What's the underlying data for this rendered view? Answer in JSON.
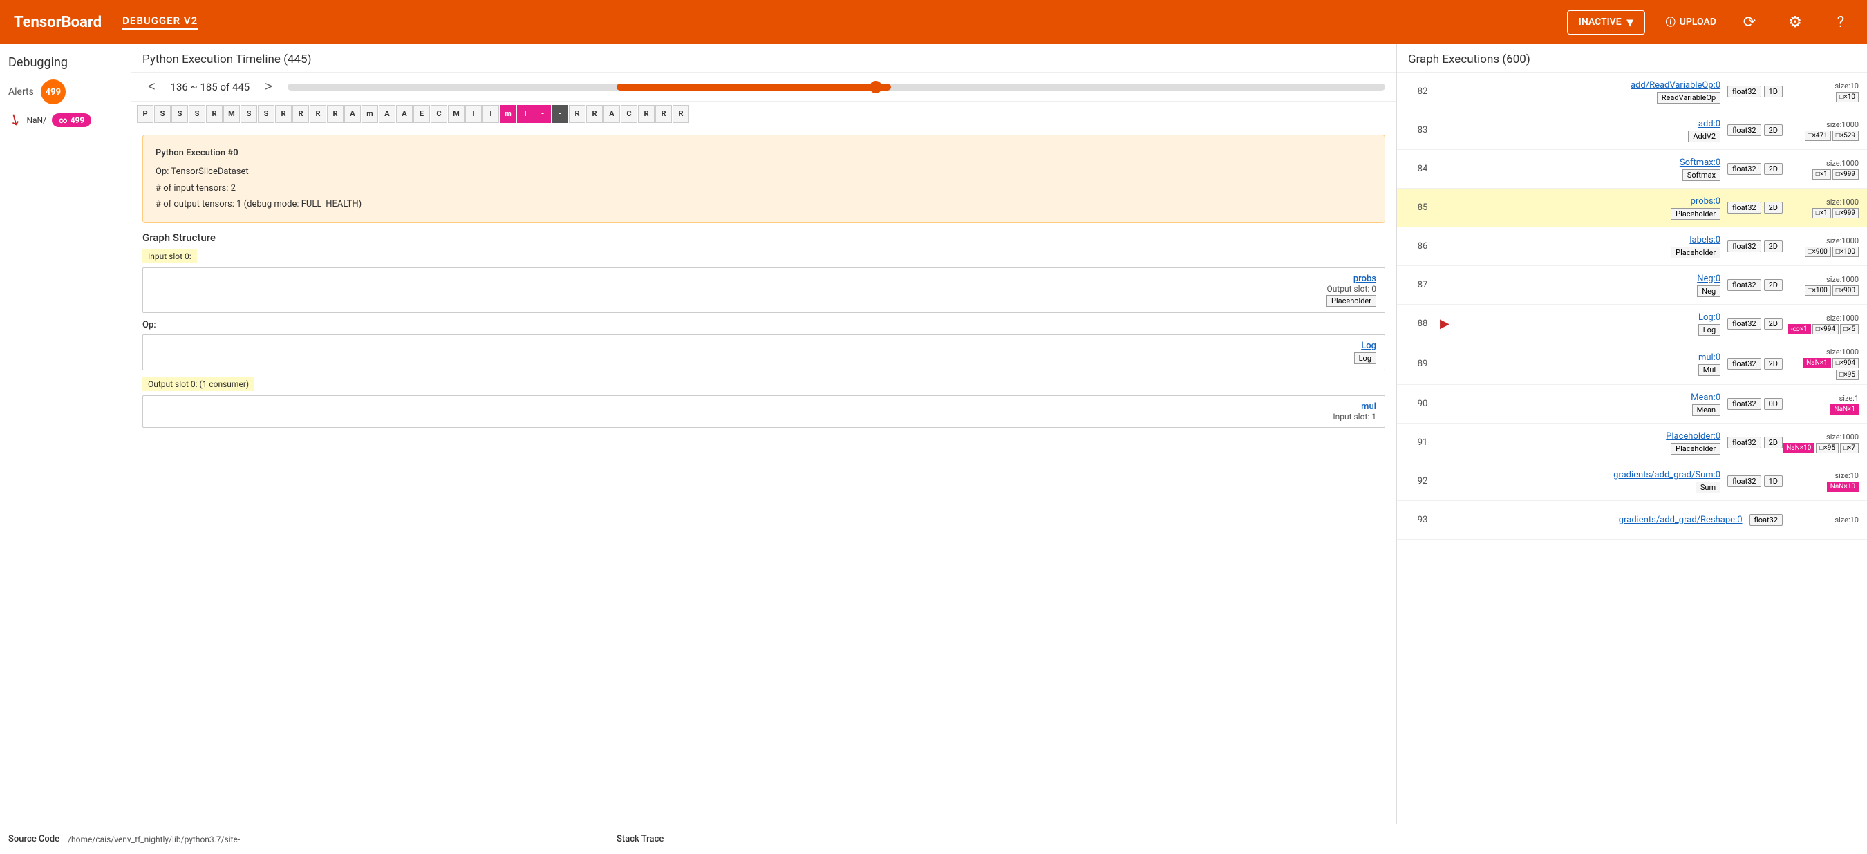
{
  "topbar": {
    "logo": "TensorBoard",
    "plugin": "DEBUGGER V2",
    "status": "INACTIVE",
    "upload_label": "UPLOAD",
    "icons": {
      "refresh": "⟳",
      "settings": "⚙",
      "help": "?",
      "info": "ⓘ",
      "chevron": "▾"
    }
  },
  "sidebar": {
    "title": "Debugging",
    "alerts_label": "Alerts",
    "alerts_count": "499",
    "nan_label": "NaN/",
    "nan_badge": "∞: 499"
  },
  "timeline": {
    "title": "Python Execution Timeline (445)",
    "range_text": "136 ~ 185 of 445",
    "prev_btn": "<",
    "next_btn": ">",
    "op_cells": [
      {
        "label": "P",
        "style": "normal"
      },
      {
        "label": "S",
        "style": "normal"
      },
      {
        "label": "S",
        "style": "normal"
      },
      {
        "label": "S",
        "style": "normal"
      },
      {
        "label": "R",
        "style": "normal"
      },
      {
        "label": "M",
        "style": "normal"
      },
      {
        "label": "S",
        "style": "normal"
      },
      {
        "label": "S",
        "style": "normal"
      },
      {
        "label": "R",
        "style": "normal"
      },
      {
        "label": "R",
        "style": "normal"
      },
      {
        "label": "R",
        "style": "normal"
      },
      {
        "label": "R",
        "style": "normal"
      },
      {
        "label": "A",
        "style": "normal"
      },
      {
        "label": "m",
        "style": "underline"
      },
      {
        "label": "A",
        "style": "normal"
      },
      {
        "label": "A",
        "style": "normal"
      },
      {
        "label": "E",
        "style": "normal"
      },
      {
        "label": "C",
        "style": "normal"
      },
      {
        "label": "M",
        "style": "normal"
      },
      {
        "label": "I",
        "style": "normal"
      },
      {
        "label": "I",
        "style": "normal"
      },
      {
        "label": "m",
        "style": "highlight-pink underline"
      },
      {
        "label": "I",
        "style": "highlight-pink"
      },
      {
        "label": "-",
        "style": "highlight-pink"
      },
      {
        "label": "-",
        "style": "highlight-dark"
      },
      {
        "label": "R",
        "style": "normal"
      },
      {
        "label": "R",
        "style": "normal"
      },
      {
        "label": "A",
        "style": "normal"
      },
      {
        "label": "C",
        "style": "normal"
      },
      {
        "label": "R",
        "style": "normal"
      },
      {
        "label": "R",
        "style": "normal"
      },
      {
        "label": "R",
        "style": "normal"
      }
    ]
  },
  "py_exec": {
    "title": "Python Execution #0",
    "op_label": "Op:",
    "op_value": "TensorSliceDataset",
    "input_tensors_label": "# of input tensors:",
    "input_tensors_value": "2",
    "output_tensors_label": "# of output tensors:",
    "output_tensors_value": "1",
    "debug_mode": "(debug mode: FULL_HEALTH)"
  },
  "graph_structure": {
    "title": "Graph Structure",
    "input_slot_label": "Input slot 0:",
    "input_card": {
      "name": "probs",
      "slot": "Output slot: 0",
      "tag": "Placeholder"
    },
    "op_label": "Op:",
    "op_card": {
      "name": "Log",
      "tag": "Log"
    },
    "output_slot_label": "Output slot 0: (1 consumer)",
    "output_card": {
      "name": "mul",
      "slot": "Input slot: 1"
    }
  },
  "graph_executions": {
    "title": "Graph Executions (600)",
    "rows": [
      {
        "num": "82",
        "arrow": false,
        "selected": false,
        "op_name": "add/ReadVariableOp:0",
        "op_type": "ReadVariableOp",
        "dtype": "float32",
        "rank": "1D",
        "size_label": "size:10",
        "dims": [
          "□×10"
        ]
      },
      {
        "num": "83",
        "arrow": false,
        "selected": false,
        "op_name": "add:0",
        "op_type": "AddV2",
        "dtype": "float32",
        "rank": "2D",
        "size_label": "size:1000",
        "dims": [
          "□×471",
          "□×529"
        ]
      },
      {
        "num": "84",
        "arrow": false,
        "selected": false,
        "op_name": "Softmax:0",
        "op_type": "Softmax",
        "dtype": "float32",
        "rank": "2D",
        "size_label": "size:1000",
        "dims": [
          "□×1",
          "□×999"
        ]
      },
      {
        "num": "85",
        "arrow": false,
        "selected": true,
        "op_name": "probs:0",
        "op_type": "Placeholder",
        "dtype": "float32",
        "rank": "2D",
        "size_label": "size:1000",
        "dims": [
          "□×1",
          "□×999"
        ]
      },
      {
        "num": "86",
        "arrow": false,
        "selected": false,
        "op_name": "labels:0",
        "op_type": "Placeholder",
        "dtype": "float32",
        "rank": "2D",
        "size_label": "size:1000",
        "dims": [
          "□×900",
          "□×100"
        ]
      },
      {
        "num": "87",
        "arrow": false,
        "selected": false,
        "op_name": "Neg:0",
        "op_type": "Neg",
        "dtype": "float32",
        "rank": "2D",
        "size_label": "size:1000",
        "dims": [
          "□×100",
          "□×900"
        ]
      },
      {
        "num": "88",
        "arrow": true,
        "selected": false,
        "op_name": "Log:0",
        "op_type": "Log",
        "dtype": "float32",
        "rank": "2D",
        "size_label": "size:1000",
        "dims": [
          "-∞×1",
          "□×994",
          "□×5"
        ],
        "dim_styles": [
          "nan",
          "normal",
          "normal"
        ]
      },
      {
        "num": "89",
        "arrow": false,
        "selected": false,
        "op_name": "mul:0",
        "op_type": "Mul",
        "dtype": "float32",
        "rank": "2D",
        "size_label": "size:1000",
        "dims": [
          "NaN×1",
          "□×904",
          "□×95"
        ],
        "dim_styles": [
          "nan",
          "normal",
          "normal"
        ]
      },
      {
        "num": "90",
        "arrow": false,
        "selected": false,
        "op_name": "Mean:0",
        "op_type": "Mean",
        "dtype": "float32",
        "rank": "0D",
        "size_label": "size:1",
        "dims": [
          "NaN×1"
        ],
        "dim_styles": [
          "nan"
        ]
      },
      {
        "num": "91",
        "arrow": false,
        "selected": false,
        "op_name": "Placeholder:0",
        "op_type": "Placeholder",
        "dtype": "float32",
        "rank": "2D",
        "size_label": "size:1000",
        "dims": [
          "NaN×10",
          "□×95",
          "□×7"
        ],
        "dim_styles": [
          "nan",
          "normal",
          "normal"
        ]
      },
      {
        "num": "92",
        "arrow": false,
        "selected": false,
        "op_name": "gradients/add_grad/Sum:0",
        "op_type": "Sum",
        "dtype": "float32",
        "rank": "1D",
        "size_label": "size:10",
        "dims": [
          "NaN×10"
        ],
        "dim_styles": [
          "nan"
        ]
      },
      {
        "num": "93",
        "arrow": false,
        "selected": false,
        "op_name": "gradients/add_grad/Reshape:0",
        "op_type": "",
        "dtype": "float32",
        "rank": "",
        "size_label": "size:10",
        "dims": [],
        "dim_styles": []
      }
    ]
  },
  "bottom": {
    "source_label": "Source Code",
    "source_path": "/home/cais/venv_tf_nightly/lib/python3.7/site-",
    "stack_label": "Stack Trace"
  }
}
